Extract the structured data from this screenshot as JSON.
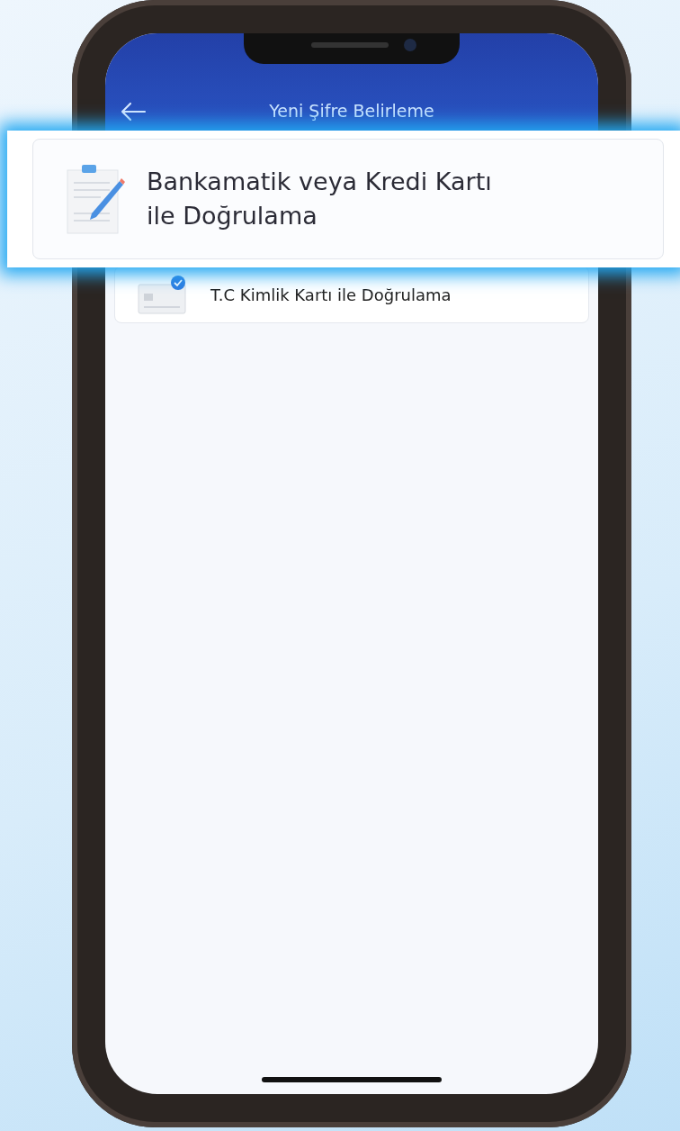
{
  "header": {
    "title": "Yeni Şifre Belirleme"
  },
  "callout": {
    "label": "Bankamatik veya Kredi Kartı ile Doğrulama",
    "kind": "form"
  },
  "options": [
    {
      "label": "T.C Kimlik Kartı ile Doğrulama",
      "kind": "id-card"
    }
  ]
}
